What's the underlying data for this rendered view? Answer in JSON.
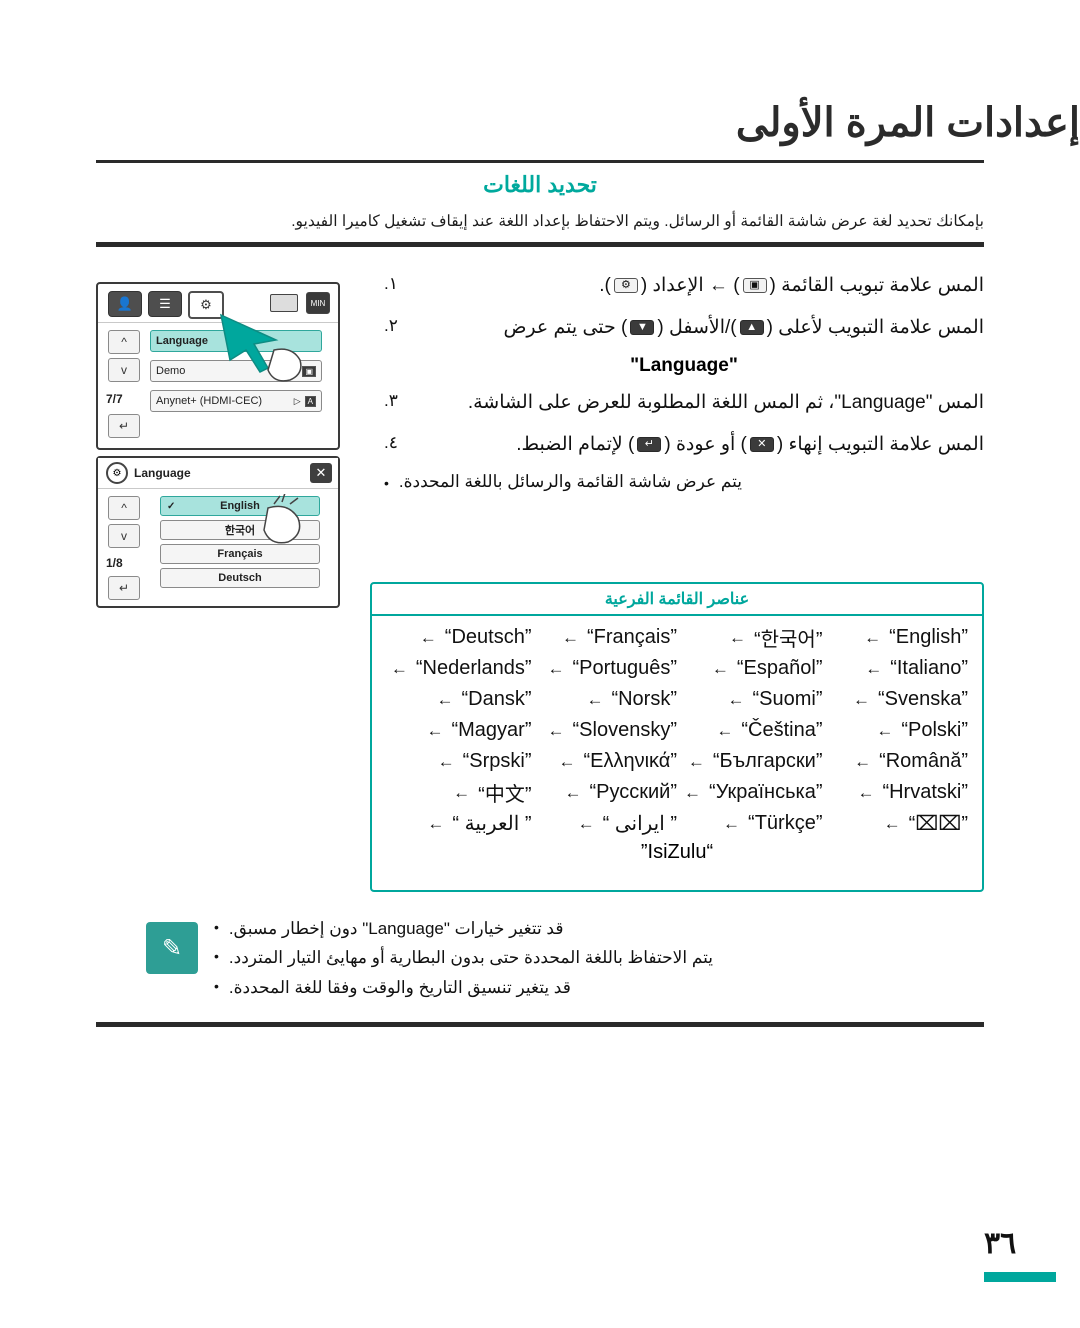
{
  "header": {
    "title": "إعدادات المرة الأولى",
    "subtitle": "تحديد اللغات",
    "intro": "بإمكانك تحديد لغة عرض شاشة القائمة أو الرسائل. ويتم الاحتفاظ بإعداد اللغة عند إيقاف تشغيل كاميرا الفيديو."
  },
  "steps": [
    {
      "num": "١.",
      "text_before": "المس علامة تبويب القائمة (",
      "icon1": "menu-tab-icon",
      "text_mid": ") ← الإعداد (",
      "icon2": "settings-gear-icon",
      "text_after": ")."
    },
    {
      "num": "٢.",
      "text_before": "المس علامة التبويب لأعلى (",
      "icon1": "up-arrow-icon",
      "text_mid": ")/الأسفل (",
      "icon2": "down-arrow-icon",
      "text_after": ") حتى يتم عرض",
      "emphasis": "\"Language\""
    },
    {
      "num": "٣.",
      "text": "المس \"Language\"، ثم المس اللغة المطلوبة للعرض على الشاشة."
    },
    {
      "num": "٤.",
      "text_before": "المس علامة التبويب إنهاء (",
      "icon1": "exit-x-icon",
      "text_mid": ") أو عودة (",
      "icon2": "return-icon",
      "text_after": ") لإتمام الضبط."
    }
  ],
  "step_bullet": "يتم عرض شاشة القائمة والرسائل باللغة المحددة.",
  "lcd1": {
    "tabs": [
      "person-icon",
      "list-icon",
      "gear-icon"
    ],
    "status": [
      "battery-icon",
      "mic-icon"
    ],
    "rows": [
      {
        "label": "Language",
        "highlighted": true
      },
      {
        "label": "Demo",
        "highlighted": false,
        "right_icon": "monitor-icon"
      },
      {
        "label": "Anynet+ (HDMI-CEC)",
        "highlighted": false,
        "right_icon": "auto-icon"
      }
    ],
    "page_indicator": "7/7",
    "up_btn": "up-arrow-icon",
    "down_btn": "down-arrow-icon",
    "back_btn": "return-icon"
  },
  "lcd2": {
    "title": "Language",
    "close": "close-x-icon",
    "rows": [
      {
        "label": "English",
        "highlighted": true,
        "check": true
      },
      {
        "label": "한국어",
        "highlighted": false
      },
      {
        "label": "Français",
        "highlighted": false
      },
      {
        "label": "Deutsch",
        "highlighted": false
      }
    ],
    "page_indicator": "1/8",
    "up_btn": "up-arrow-icon",
    "down_btn": "down-arrow-icon",
    "back_btn": "return-icon"
  },
  "language_panel": {
    "heading": "عناصر القائمة الفرعية",
    "rows": [
      [
        "“English”",
        "“한국어”",
        "“Français”",
        "“Deutsch”"
      ],
      [
        "“Italiano”",
        "“Español”",
        "“Português”",
        "“Nederlands”"
      ],
      [
        "“Svenska”",
        "“Suomi”",
        "“Norsk”",
        "“Dansk”"
      ],
      [
        "“Polski”",
        "“Čeština”",
        "“Slovensky”",
        "“Magyar”"
      ],
      [
        "“Română”",
        "“Български”",
        "“Ελληνικά”",
        "“Srpski”"
      ],
      [
        "“Hrvatski”",
        "“Українська”",
        "“Русский”",
        "“中文”"
      ],
      [
        "“⌧⌧”",
        "“Türkçe”",
        "“ ایرانی ”",
        "“ العربية ”"
      ]
    ],
    "last_row": "“IsiZulu”",
    "arrow": "←"
  },
  "notes": [
    "قد تتغير خيارات \"Language\" دون إخطار مسبق.",
    "يتم الاحتفاظ باللغة المحددة حتى بدون البطارية أو مهايئ التيار المتردد.",
    "قد يتغير تنسيق التاريخ والوقت وفقا للغة المحددة."
  ],
  "note_icon": "note-pencil-icon",
  "footer": {
    "page_number": "٣٦"
  }
}
